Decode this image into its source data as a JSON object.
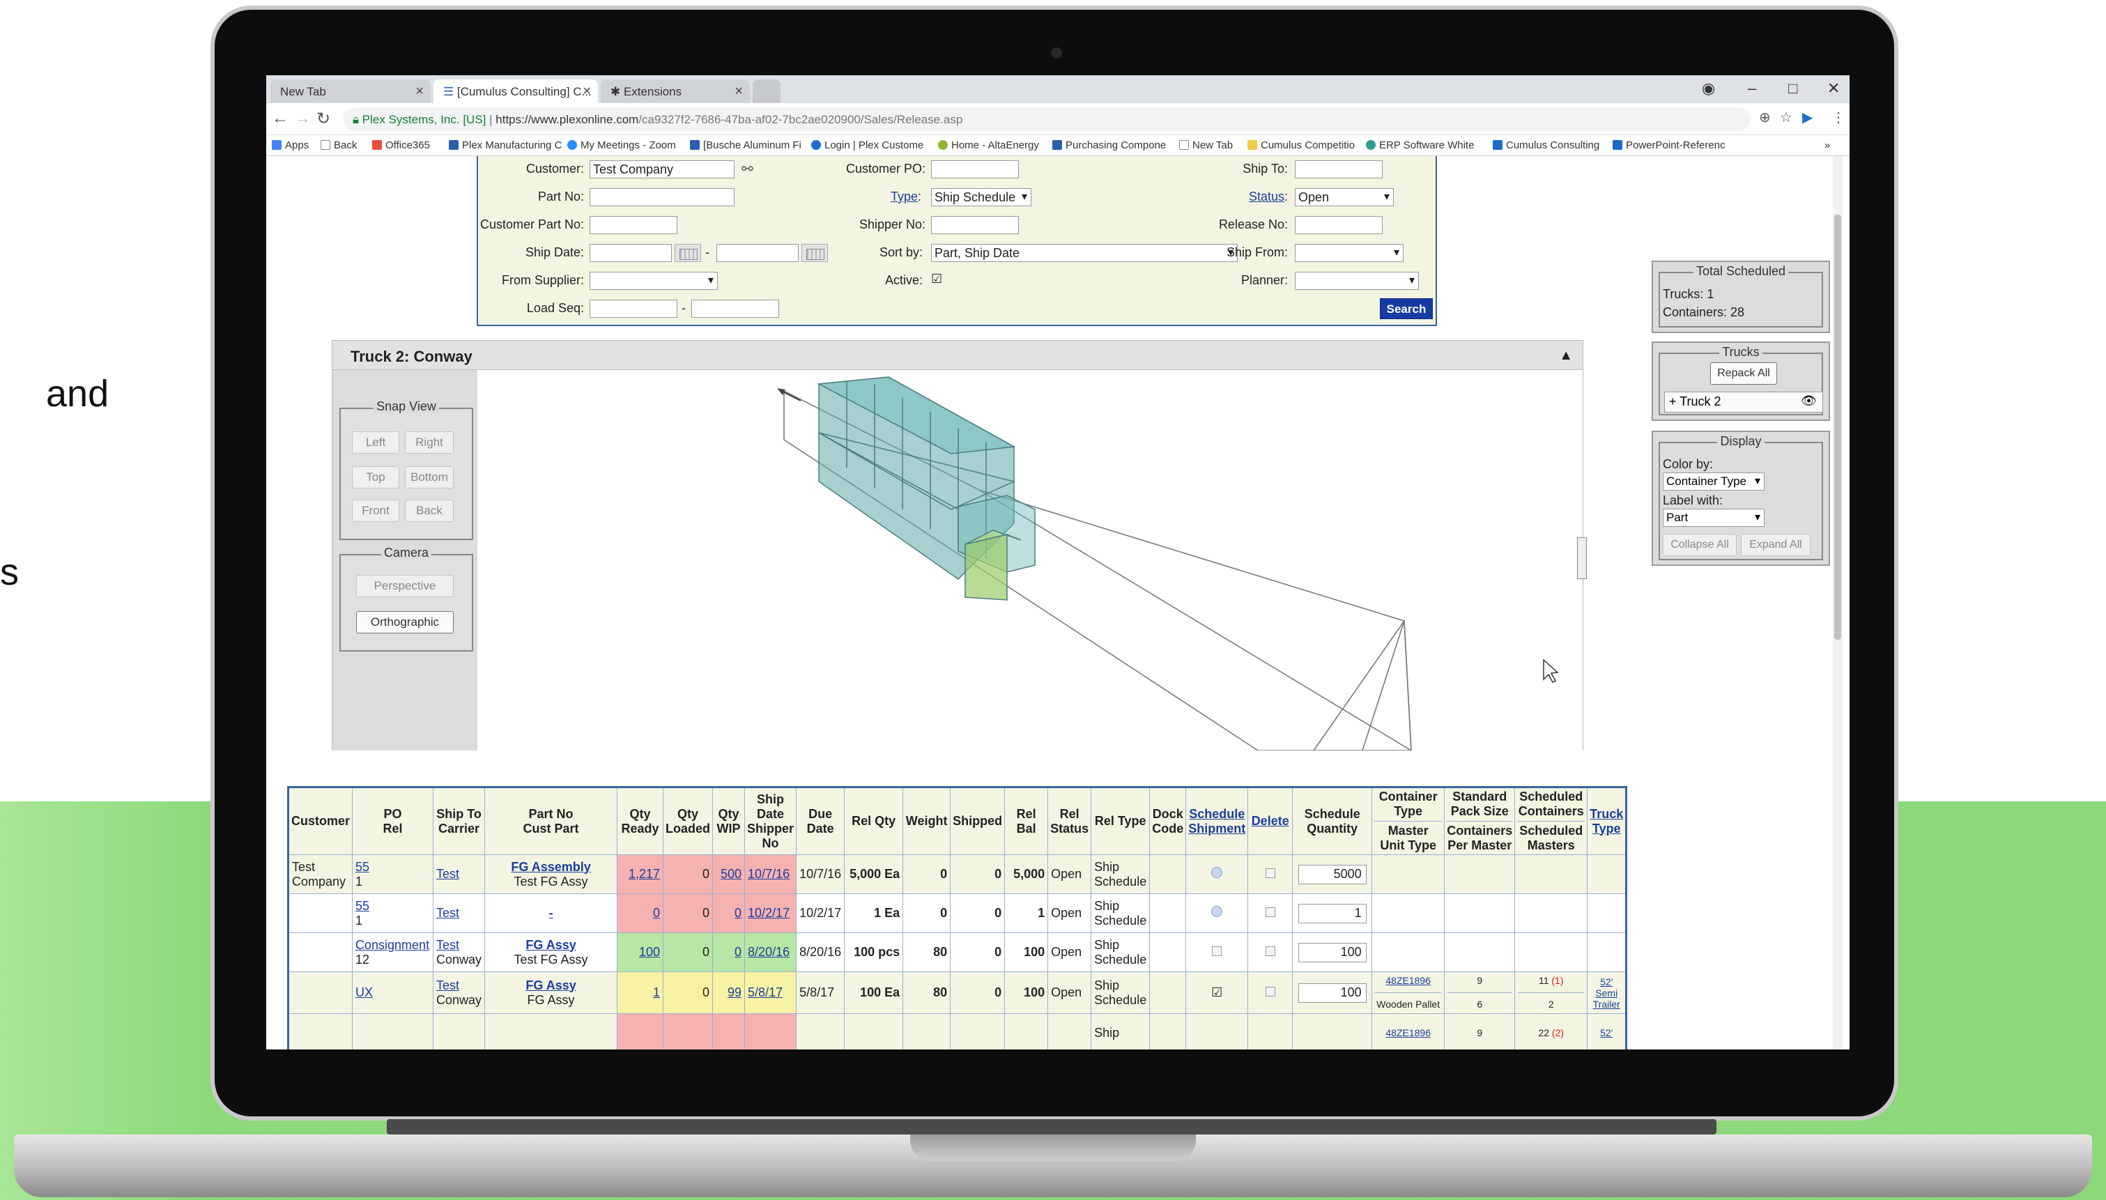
{
  "slide": {
    "side_text_1": "and",
    "side_text_2": "s"
  },
  "browser": {
    "tabs": [
      {
        "label": "New Tab"
      },
      {
        "label": "[Cumulus Consulting] C..."
      },
      {
        "label": "Extensions"
      }
    ],
    "url_prefix": "Plex Systems, Inc. [US]",
    "url_host": "https://www.plexonline.com",
    "url_path": "/ca9327f2-7686-47ba-af02-7bc2ae020900/Sales/Release.asp",
    "bookmarks": [
      {
        "label": "Apps",
        "color": "#4285f4"
      },
      {
        "label": "Back",
        "color": "#ffffff"
      },
      {
        "label": "Office365",
        "color": "#e74c3c"
      },
      {
        "label": "Plex Manufacturing C",
        "color": "#2a5db0"
      },
      {
        "label": "My Meetings - Zoom",
        "color": "#2d8cff"
      },
      {
        "label": "[Busche Aluminum Fi",
        "color": "#2a5db0"
      },
      {
        "label": "Login | Plex Custome",
        "color": "#1c6fd1"
      },
      {
        "label": "Home - AltaEnergy",
        "color": "#8fb531"
      },
      {
        "label": "Purchasing Compone",
        "color": "#2a5db0"
      },
      {
        "label": "New Tab",
        "color": "#ffffff"
      },
      {
        "label": "Cumulus Competitio",
        "color": "#f2c94c"
      },
      {
        "label": "ERP Software White",
        "color": "#2a9d8f"
      },
      {
        "label": "Cumulus Consulting",
        "color": "#1b6ac9"
      },
      {
        "label": "PowerPoint-Referenc",
        "color": "#1b6ac9"
      }
    ],
    "more": "»"
  },
  "search": {
    "customer_label": "Customer:",
    "customer_value": "Test Company",
    "customer_po_label": "Customer PO:",
    "ship_to_label": "Ship To:",
    "part_no_label": "Part No:",
    "type_label": "Type",
    "type_value": "Ship Schedule",
    "status_label": "Status",
    "status_value": "Open",
    "customer_part_no_label": "Customer Part No:",
    "shipper_no_label": "Shipper No:",
    "release_no_label": "Release No:",
    "ship_date_label": "Ship Date:",
    "dash": "-",
    "sort_by_label": "Sort by:",
    "sort_by_value": "Part, Ship Date",
    "ship_from_label": "Ship From:",
    "from_supplier_label": "From Supplier:",
    "active_label": "Active:",
    "active_mark": "☑",
    "planner_label": "Planner:",
    "load_seq_label": "Load Seq:",
    "search_button": "Search"
  },
  "truck": {
    "title": "Truck 2: Conway",
    "collapse_glyph": "▲",
    "snap_view_title": "Snap View",
    "snap_buttons": [
      "Left",
      "Right",
      "Top",
      "Bottom",
      "Front",
      "Back"
    ],
    "camera_title": "Camera",
    "camera_buttons": [
      "Perspective",
      "Orthographic"
    ]
  },
  "right_panel": {
    "total_title": "Total Scheduled",
    "trucks_line": "Trucks: 1",
    "containers_line": "Containers: 28",
    "trucks_title": "Trucks",
    "repack_all": "Repack All",
    "truck_item": "+ Truck 2",
    "display_title": "Display",
    "color_by_label": "Color by:",
    "color_by_value": "Container Type",
    "label_with_label": "Label with:",
    "label_with_value": "Part",
    "collapse_all": "Collapse All",
    "expand_all": "Expand All"
  },
  "table": {
    "headers": {
      "customer": "Customer",
      "po": "PO",
      "rel": "Rel",
      "ship_to": "Ship To",
      "carrier": "Carrier",
      "part_no": "Part No",
      "cust_part": "Cust Part",
      "qty_ready": "Qty Ready",
      "qty_loaded": "Qty Loaded",
      "qty_wip": "Qty WIP",
      "ship_date": "Ship Date",
      "shipper_no": "Shipper No",
      "due_date": "Due Date",
      "rel_qty": "Rel Qty",
      "weight": "Weight",
      "shipped": "Shipped",
      "rel_bal": "Rel Bal",
      "rel_status": "Rel Status",
      "rel_type": "Rel Type",
      "dock_code": "Dock Code",
      "schedule_shipment": "Schedule Shipment",
      "delete": "Delete",
      "schedule_quantity": "Schedule Quantity",
      "container_type": "Container Type",
      "master_unit_type": "Master Unit Type",
      "standard_pack_size": "Standard Pack Size",
      "containers_per_master": "Containers Per Master",
      "scheduled_containers": "Scheduled Containers",
      "scheduled_masters": "Scheduled Masters",
      "truck_type": "Truck Type"
    },
    "rows": [
      {
        "customer": "Test Company",
        "po": "55",
        "rel": "1",
        "ship_to": "Test",
        "carrier": "",
        "part_no": "FG Assembly",
        "cust_part": "Test FG Assy",
        "qty_ready": "1,217",
        "qty_loaded": "0",
        "qty_wip": "500",
        "ship_date": "10/7/16",
        "due_date": "10/7/16",
        "rel_qty": "5,000 Ea",
        "weight": "0",
        "shipped": "0",
        "rel_bal": "5,000",
        "status": "Open",
        "type": "Ship Schedule",
        "sched_qty": "5000",
        "container_type": "",
        "master_unit": "",
        "pack_size": "",
        "per_master": "",
        "sched_containers": "",
        "sched_masters": "",
        "truck_type": "",
        "ready_color": "red"
      },
      {
        "customer": "",
        "po": "55",
        "rel": "1",
        "ship_to": "Test",
        "carrier": "",
        "part_no": "-",
        "cust_part": "",
        "qty_ready": "0",
        "qty_loaded": "0",
        "qty_wip": "0",
        "ship_date": "10/2/17",
        "due_date": "10/2/17",
        "rel_qty": "1 Ea",
        "weight": "0",
        "shipped": "0",
        "rel_bal": "1",
        "status": "Open",
        "type": "Ship Schedule",
        "sched_qty": "1",
        "container_type": "",
        "master_unit": "",
        "pack_size": "",
        "per_master": "",
        "sched_containers": "",
        "sched_masters": "",
        "truck_type": "",
        "ready_color": "red"
      },
      {
        "customer": "",
        "po": "Consignment",
        "rel": "12",
        "ship_to": "Test",
        "carrier": "Conway",
        "part_no": "FG Assy",
        "cust_part": "Test FG Assy",
        "qty_ready": "100",
        "qty_loaded": "0",
        "qty_wip": "0",
        "ship_date": "8/20/16",
        "due_date": "8/20/16",
        "rel_qty": "100 pcs",
        "weight": "80",
        "shipped": "0",
        "rel_bal": "100",
        "status": "Open",
        "type": "Ship Schedule",
        "sched_qty": "100",
        "container_type": "",
        "master_unit": "",
        "pack_size": "",
        "per_master": "",
        "sched_containers": "",
        "sched_masters": "",
        "truck_type": "",
        "ready_color": "grn"
      },
      {
        "customer": "",
        "po": "UX",
        "rel": "",
        "ship_to": "Test",
        "carrier": "Conway",
        "part_no": "FG Assy",
        "cust_part": "FG Assy",
        "qty_ready": "1",
        "qty_loaded": "0",
        "qty_wip": "99",
        "ship_date": "5/8/17",
        "due_date": "5/8/17",
        "rel_qty": "100 Ea",
        "weight": "80",
        "shipped": "0",
        "rel_bal": "100",
        "status": "Open",
        "type": "Ship Schedule",
        "sched_qty": "100",
        "container_type": "48ZE1896",
        "master_unit": "Wooden Pallet",
        "pack_size": "9",
        "per_master": "6",
        "sched_containers": "11",
        "sched_containers_extra": "(1)",
        "sched_masters": "2",
        "truck_type": "52' Semi Trailer",
        "ready_color": "yel"
      }
    ],
    "partial_row": {
      "container_type": "48ZE1896",
      "pack_size": "9",
      "sched_containers": "22",
      "sched_containers_extra": "(2)",
      "truck_type": "52'",
      "type": "Ship"
    }
  }
}
